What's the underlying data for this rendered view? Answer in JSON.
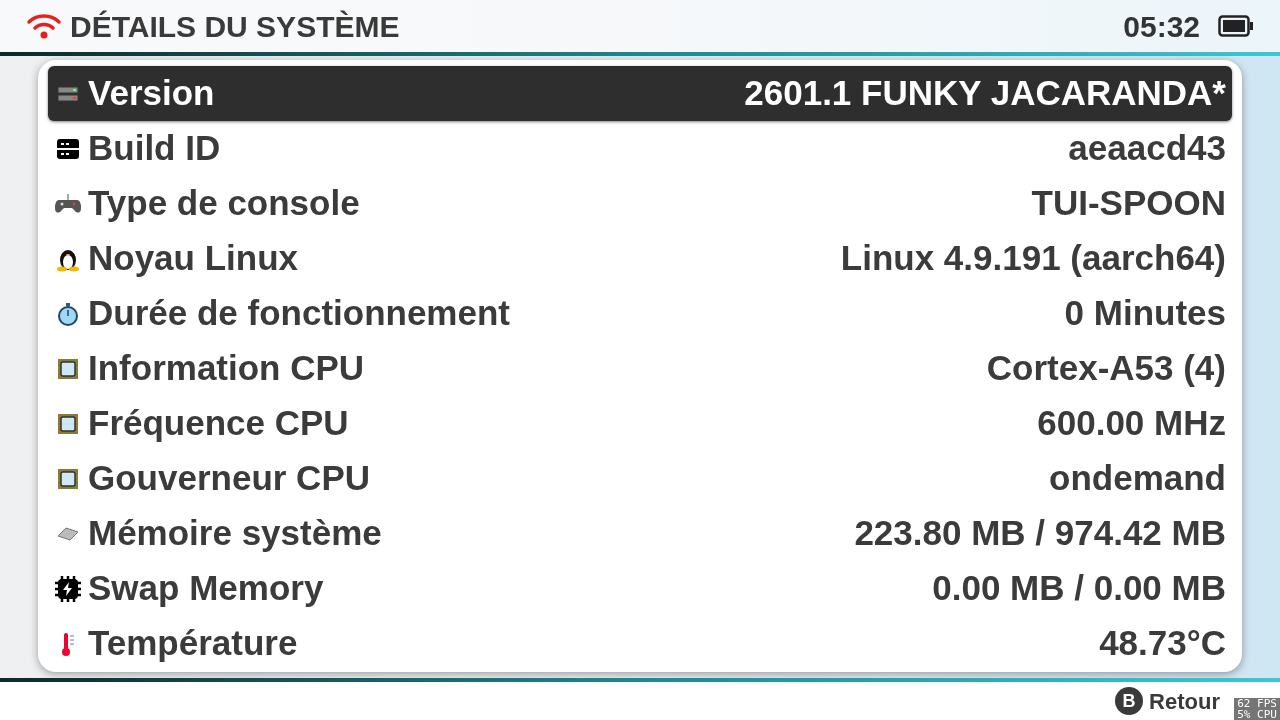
{
  "header": {
    "title": "DÉTAILS DU SYSTÈME",
    "time": "05:32"
  },
  "rows": [
    {
      "kind": "server",
      "label": "Version",
      "value": "2601.1 FUNKY JACARANDA*",
      "selected": true
    },
    {
      "kind": "drive",
      "label": "Build ID",
      "value": "aeaacd43",
      "selected": false
    },
    {
      "kind": "gamepad",
      "label": "Type de console",
      "value": "TUI-SPOON",
      "selected": false
    },
    {
      "kind": "penguin",
      "label": "Noyau Linux",
      "value": "Linux 4.9.191 (aarch64)",
      "selected": false
    },
    {
      "kind": "stopwatch",
      "label": "Durée de fonctionnement",
      "value": "0 Minutes",
      "selected": false
    },
    {
      "kind": "chip",
      "label": "Information CPU",
      "value": "Cortex-A53 (4)",
      "selected": false
    },
    {
      "kind": "chip",
      "label": "Fréquence CPU",
      "value": "600.00 MHz",
      "selected": false
    },
    {
      "kind": "chip",
      "label": "Gouverneur CPU",
      "value": "ondemand",
      "selected": false
    },
    {
      "kind": "memory",
      "label": "Mémoire système",
      "value": "223.80 MB / 974.42 MB",
      "selected": false
    },
    {
      "kind": "swap",
      "label": "Swap Memory",
      "value": "0.00 MB / 0.00 MB",
      "selected": false
    },
    {
      "kind": "thermometer",
      "label": "Température",
      "value": "48.73°C",
      "selected": false
    }
  ],
  "footer": {
    "button_glyph": "B",
    "button_label": "Retour"
  },
  "overlay": {
    "fps": "62 FPS",
    "cpu": "5% CPU"
  }
}
